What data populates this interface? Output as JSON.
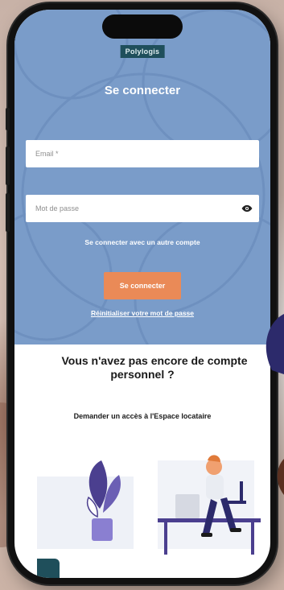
{
  "app": {
    "brand": "Polylogis"
  },
  "login": {
    "title": "Se connecter",
    "email_placeholder": "Email *",
    "password_placeholder": "Mot de passe",
    "alt_login_link": "Se connecter avec un autre compte",
    "submit_label": "Se connecter",
    "reset_link": "Réinitialiser votre mot de passe"
  },
  "signup": {
    "question_line1": "Vous n'avez pas encore de compte",
    "question_line2": "personnel ?",
    "request_link": "Demander un accès à l'Espace locataire"
  },
  "colors": {
    "header_bg": "#7a9cc9",
    "accent": "#ea8a57",
    "brand_bg": "#1f4f5b",
    "illustration_purple": "#4b3f8f"
  },
  "icons": {
    "password_toggle": "eye-icon",
    "corner": "app-corner-icon"
  }
}
